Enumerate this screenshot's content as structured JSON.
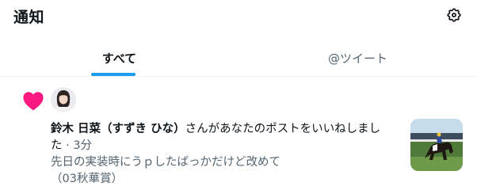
{
  "header": {
    "title": "通知",
    "settings_icon": "gear-icon"
  },
  "tabs": [
    {
      "label": "すべて",
      "active": true
    },
    {
      "label": "@ツイート",
      "active": false
    }
  ],
  "notification": {
    "type_icon": "heart-icon",
    "type_color": "#f91880",
    "user_name": "鈴木 日菜（すずき ひな）",
    "action_text_1": "さんがあなたのポストをいいねしまし",
    "action_text_2": "た",
    "time": "· 3分",
    "quote_line_1": "先日の実装時にうｐしたばっかだけど改めて",
    "quote_line_2": "（03秋華賞）"
  },
  "colors": {
    "accent": "#1d9bf0",
    "text_primary": "#0f1419",
    "text_secondary": "#536471"
  }
}
